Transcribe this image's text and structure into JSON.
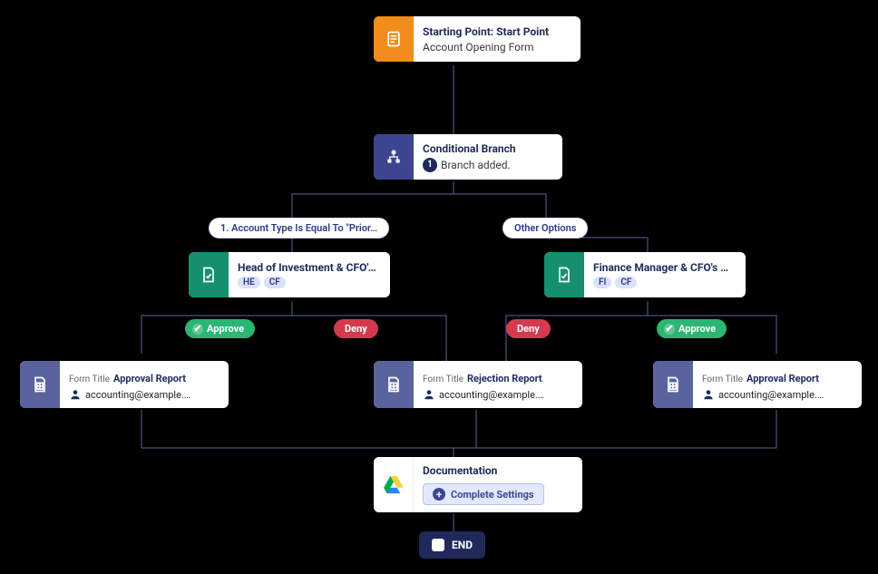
{
  "start": {
    "title": "Starting Point: Start Point",
    "subtitle": "Account Opening Form"
  },
  "cond": {
    "title": "Conditional Branch",
    "count": "1",
    "text": "Branch added."
  },
  "branchLabels": {
    "left": "1. Account Type Is Equal To \"Prior…",
    "right": "Other Options"
  },
  "approvalLeft": {
    "title": "Head of Investment & CFO's …",
    "tags": [
      "HE",
      "CF"
    ]
  },
  "approvalRight": {
    "title": "Finance Manager & CFO's A…",
    "tags": [
      "FI",
      "CF"
    ]
  },
  "status": {
    "approve": "Approve",
    "deny": "Deny"
  },
  "reports": {
    "left": {
      "pre": "Form Title",
      "title": "Approval Report",
      "user": "accounting@example.…"
    },
    "mid": {
      "pre": "Form Title",
      "title": "Rejection Report",
      "user": "accounting@example.…"
    },
    "right": {
      "pre": "Form Title",
      "title": "Approval Report",
      "user": "accounting@example.…"
    }
  },
  "doc": {
    "title": "Documentation",
    "btn": "Complete Settings"
  },
  "end": "END"
}
